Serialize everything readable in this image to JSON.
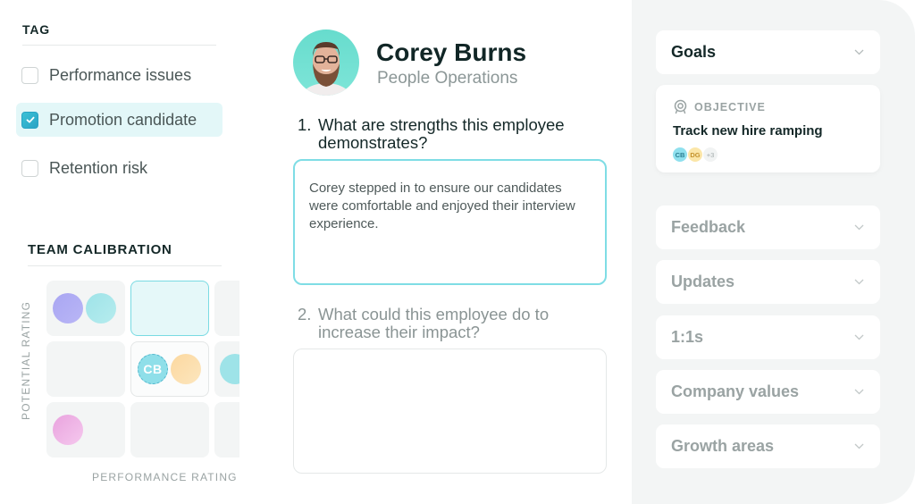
{
  "tag": {
    "title": "TAG",
    "items": [
      {
        "label": "Performance issues",
        "checked": false
      },
      {
        "label": "Promotion candidate",
        "checked": true
      },
      {
        "label": "Retention risk",
        "checked": false
      }
    ]
  },
  "calibration": {
    "title": "TEAM CALIBRATION",
    "y_axis_label": "POTENTIAL RATING",
    "x_axis_label": "PERFORMANCE RATING",
    "current_employee_initials": "CB"
  },
  "employee": {
    "name": "Corey Burns",
    "department": "People Operations",
    "avatar": "employee-photo"
  },
  "questions": [
    {
      "number": "1.",
      "text": "What are strengths this employee demonstrates?",
      "answer": "Corey stepped in to ensure our candidates were comfortable and enjoyed their interview experience."
    },
    {
      "number": "2.",
      "text": "What could this employee do to increase their impact?",
      "answer": ""
    }
  ],
  "sidebar": {
    "goals_label": "Goals",
    "objective": {
      "kicker": "OBJECTIVE",
      "title": "Track new hire ramping",
      "assignees": [
        {
          "initials": "CB",
          "color": "#8fe0ee",
          "text_color": "#2b7f93"
        },
        {
          "initials": "DG",
          "color": "#fbe6a8",
          "text_color": "#c4922c"
        }
      ],
      "more_count": "+3"
    },
    "sections": [
      "Feedback",
      "Updates",
      "1:1s",
      "Company values",
      "Growth areas"
    ]
  },
  "colors": {
    "accent": "#3cc1d6",
    "accent_light": "#e3f7f8",
    "panel_bg": "#f3f5f5",
    "text_dark": "#142828",
    "text_muted": "#9aa3a3"
  }
}
